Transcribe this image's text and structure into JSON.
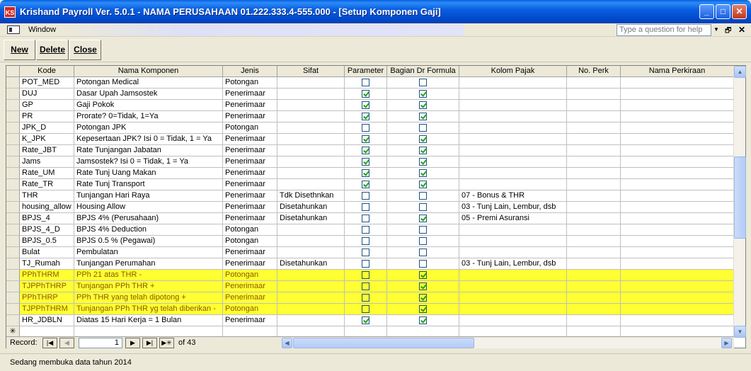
{
  "window": {
    "title": "Krishand Payroll Ver. 5.0.1 - NAMA PERUSAHAAN 01.222.333.4-555.000 - [Setup Komponen Gaji]",
    "app_icon": "KS",
    "minimize": "_",
    "maximize": "□",
    "close": "✕"
  },
  "menubar": {
    "window_label": "Window",
    "question_placeholder": "Type a question for help",
    "dropdown": "▼",
    "restore": "🗗",
    "close": "✕"
  },
  "toolbar": {
    "new_label": "New",
    "delete_label": "Delete",
    "close_label": "Close"
  },
  "grid": {
    "columns": [
      "Kode",
      "Nama Komponen",
      "Jenis",
      "Sifat",
      "Parameter",
      "Bagian Dr Formula",
      "Kolom Pajak",
      "No. Perk",
      "Nama Perkiraan"
    ],
    "rows": [
      {
        "kode": "POT_MED",
        "nama": "Potongan Medical",
        "jenis": "Potongan",
        "sifat": "",
        "parameter": false,
        "formula": false,
        "pajak": "",
        "hl": false
      },
      {
        "kode": "DUJ",
        "nama": "Dasar Upah Jamsostek",
        "jenis": "Penerimaar",
        "sifat": "",
        "parameter": true,
        "formula": true,
        "pajak": "",
        "hl": false
      },
      {
        "kode": "GP",
        "nama": "Gaji Pokok",
        "jenis": "Penerimaar",
        "sifat": "",
        "parameter": true,
        "formula": true,
        "pajak": "",
        "hl": false
      },
      {
        "kode": "PR",
        "nama": "Prorate? 0=Tidak, 1=Ya",
        "jenis": "Penerimaar",
        "sifat": "",
        "parameter": true,
        "formula": true,
        "pajak": "",
        "hl": false
      },
      {
        "kode": "JPK_D",
        "nama": "Potongan JPK",
        "jenis": "Potongan",
        "sifat": "",
        "parameter": false,
        "formula": false,
        "pajak": "",
        "hl": false
      },
      {
        "kode": "K_JPK",
        "nama": "Kepesertaan JPK? Isi 0 = Tidak, 1 = Ya",
        "jenis": "Penerimaar",
        "sifat": "",
        "parameter": true,
        "formula": true,
        "pajak": "",
        "hl": false
      },
      {
        "kode": "Rate_JBT",
        "nama": "Rate Tunjangan Jabatan",
        "jenis": "Penerimaar",
        "sifat": "",
        "parameter": true,
        "formula": true,
        "pajak": "",
        "hl": false
      },
      {
        "kode": "Jams",
        "nama": "Jamsostek? Isi 0 = Tidak, 1 = Ya",
        "jenis": "Penerimaar",
        "sifat": "",
        "parameter": true,
        "formula": true,
        "pajak": "",
        "hl": false
      },
      {
        "kode": "Rate_UM",
        "nama": "Rate Tunj Uang Makan",
        "jenis": "Penerimaar",
        "sifat": "",
        "parameter": true,
        "formula": true,
        "pajak": "",
        "hl": false
      },
      {
        "kode": "Rate_TR",
        "nama": "Rate Tunj Transport",
        "jenis": "Penerimaar",
        "sifat": "",
        "parameter": true,
        "formula": true,
        "pajak": "",
        "hl": false
      },
      {
        "kode": "THR",
        "nama": "Tunjangan Hari Raya",
        "jenis": "Penerimaar",
        "sifat": "Tdk Disethnkan",
        "parameter": false,
        "formula": false,
        "pajak": "07 - Bonus & THR",
        "hl": false
      },
      {
        "kode": "housing_allow",
        "nama": "Housing Allow",
        "jenis": "Penerimaar",
        "sifat": "Disetahunkan",
        "parameter": false,
        "formula": false,
        "pajak": "03 - Tunj Lain, Lembur, dsb",
        "hl": false
      },
      {
        "kode": "BPJS_4",
        "nama": "BPJS 4%  (Perusahaan)",
        "jenis": "Penerimaar",
        "sifat": "Disetahunkan",
        "parameter": false,
        "formula": true,
        "pajak": "05 - Premi Asuransi",
        "hl": false
      },
      {
        "kode": "BPJS_4_D",
        "nama": "BPJS 4% Deduction",
        "jenis": "Potongan",
        "sifat": "",
        "parameter": false,
        "formula": false,
        "pajak": "",
        "hl": false
      },
      {
        "kode": "BPJS_0.5",
        "nama": "BPJS 0.5 % (Pegawai)",
        "jenis": "Potongan",
        "sifat": "",
        "parameter": false,
        "formula": false,
        "pajak": "",
        "hl": false
      },
      {
        "kode": "Bulat",
        "nama": "Pembulatan",
        "jenis": "Penerimaar",
        "sifat": "",
        "parameter": false,
        "formula": false,
        "pajak": "",
        "hl": false
      },
      {
        "kode": "TJ_Rumah",
        "nama": "Tunjangan Perumahan",
        "jenis": "Penerimaar",
        "sifat": "Disetahunkan",
        "parameter": false,
        "formula": false,
        "pajak": "03 - Tunj Lain, Lembur, dsb",
        "hl": false
      },
      {
        "kode": "PPhTHRM",
        "nama": "PPh 21 atas THR -",
        "jenis": "Potongan",
        "sifat": "",
        "parameter": false,
        "formula": true,
        "pajak": "",
        "hl": true
      },
      {
        "kode": "TJPPhTHRP",
        "nama": "Tunjangan PPh THR +",
        "jenis": "Penerimaar",
        "sifat": "",
        "parameter": false,
        "formula": true,
        "pajak": "",
        "hl": true
      },
      {
        "kode": "PPhTHRP",
        "nama": "PPh THR yang telah dipotong +",
        "jenis": "Penerimaar",
        "sifat": "",
        "parameter": false,
        "formula": true,
        "pajak": "",
        "hl": true
      },
      {
        "kode": "TJPPhTHRM",
        "nama": "Tunjangan PPh THR yg telah diberikan -",
        "jenis": "Potongan",
        "sifat": "",
        "parameter": false,
        "formula": true,
        "pajak": "",
        "hl": true
      },
      {
        "kode": "HR_JDBLN",
        "nama": "Diatas 15 Hari Kerja = 1 Bulan",
        "jenis": "Penerimaar",
        "sifat": "",
        "parameter": true,
        "formula": true,
        "pajak": "",
        "hl": false
      }
    ],
    "new_row_marker": "✳"
  },
  "navigator": {
    "record_label": "Record:",
    "first": "|◀",
    "prev": "◀",
    "current": "1",
    "next": "▶",
    "last": "▶|",
    "new": "▶✳",
    "of_label": "of  43"
  },
  "status": {
    "text": "Sedang membuka data tahun 2014"
  },
  "colors": {
    "highlight": "#ffff33",
    "titlebar": "#0a5fe2"
  }
}
